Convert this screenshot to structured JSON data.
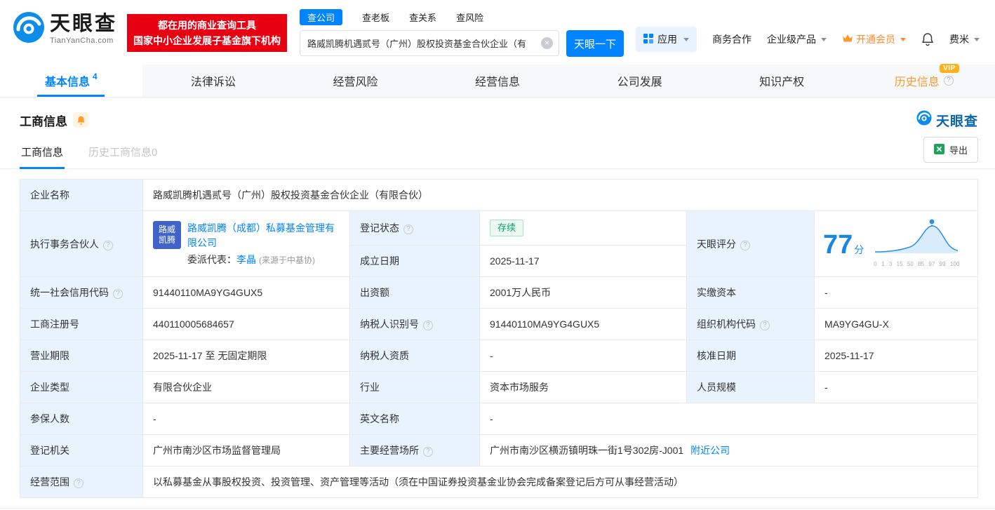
{
  "colors": {
    "accent": "#0084ff",
    "brand_red": "#e60012",
    "vip_orange": "#ff8b2c",
    "status_green": "#00a36b",
    "label_cell_bg": "#e9f3fd"
  },
  "icons": {
    "help": "?",
    "clear": "×"
  },
  "header": {
    "logo": {
      "brand": "天眼查",
      "domain": "TianYanCha.com"
    },
    "promo": {
      "line1": "都在用的商业查询工具",
      "line2": "国家中小企业发展子基金旗下机构"
    },
    "search": {
      "tabs": [
        {
          "label": "查公司",
          "active": true
        },
        {
          "label": "查老板",
          "active": false
        },
        {
          "label": "查关系",
          "active": false
        },
        {
          "label": "查风险",
          "active": false
        }
      ],
      "value": "路威凯腾机遇贰号（广州）股权投资基金合伙企业（有",
      "button": "天眼一下"
    },
    "menu": {
      "apps": "应用",
      "cooperation": "商务合作",
      "enterprise": "企业级产品",
      "vip": "开通会员",
      "user": "费米"
    }
  },
  "nav": {
    "tabs": [
      {
        "label": "基本信息",
        "count": "4",
        "active": true
      },
      {
        "label": "法律诉讼"
      },
      {
        "label": "经营风险"
      },
      {
        "label": "经营信息"
      },
      {
        "label": "公司发展"
      },
      {
        "label": "知识产权"
      },
      {
        "label": "历史信息",
        "badge": "VIP"
      }
    ]
  },
  "section": {
    "title": "工商信息",
    "logo_text": "天眼查",
    "sub_tabs": [
      {
        "label": "工商信息",
        "active": true
      },
      {
        "label": "历史工商信息0",
        "active": false
      }
    ],
    "export": "导出"
  },
  "info": {
    "company_name": {
      "label": "企业名称",
      "value": "路威凯腾机遇贰号（广州）股权投资基金合伙企业（有限合伙）"
    },
    "partner": {
      "label": "执行事务合伙人",
      "logo_line1": "路威",
      "logo_line2": "凯腾",
      "company": "路威凯腾（成都）私募基金管理有限公司",
      "rep_label": "委派代表：",
      "rep_name": "李晶",
      "rep_source": "(来源于中基协)"
    },
    "reg_status": {
      "label": "登记状态",
      "value": "存续"
    },
    "establish_date": {
      "label": "成立日期",
      "value": "2025-11-17"
    },
    "credit_code": {
      "label": "统一社会信用代码",
      "value": "91440110MA9YG4GUX5"
    },
    "capital": {
      "label": "出资额",
      "value": "2001万人民币"
    },
    "paid_in_capital": {
      "label": "实缴资本",
      "value": "-"
    },
    "reg_number": {
      "label": "工商注册号",
      "value": "440110005684657"
    },
    "taxpayer_id": {
      "label": "纳税人识别号",
      "value": "91440110MA9YG4GUX5"
    },
    "org_code": {
      "label": "组织机构代码",
      "value": "MA9YG4GU-X"
    },
    "business_term": {
      "label": "营业期限",
      "value": "2025-11-17 至 无固定期限"
    },
    "taxpayer_qualification": {
      "label": "纳税人资质",
      "value": "-"
    },
    "approval_date": {
      "label": "核准日期",
      "value": "2025-11-17"
    },
    "company_type": {
      "label": "企业类型",
      "value": "有限合伙企业"
    },
    "industry": {
      "label": "行业",
      "value": "资本市场服务"
    },
    "staff_size": {
      "label": "人员规模",
      "value": "-"
    },
    "insured_count": {
      "label": "参保人数",
      "value": "-"
    },
    "english_name": {
      "label": "英文名称",
      "value": "-"
    },
    "registry": {
      "label": "登记机关",
      "value": "广州市南沙区市场监督管理局"
    },
    "address": {
      "label": "主要经营场所",
      "value": "广州市南沙区横沥镇明珠一街1号302房-J001",
      "nearby": "附近公司"
    },
    "business_scope": {
      "label": "经营范围",
      "value": "以私募基金从事股权投资、投资管理、资产管理等活动（须在中国证券投资基金业协会完成备案登记后方可从事经营活动）"
    }
  },
  "score_chart": {
    "type": "line",
    "label": "天眼评分",
    "score": 77,
    "unit": "分",
    "x_ticks": [
      "0",
      "1",
      "3",
      "15",
      "50",
      "85",
      "97",
      "99",
      "100"
    ]
  }
}
